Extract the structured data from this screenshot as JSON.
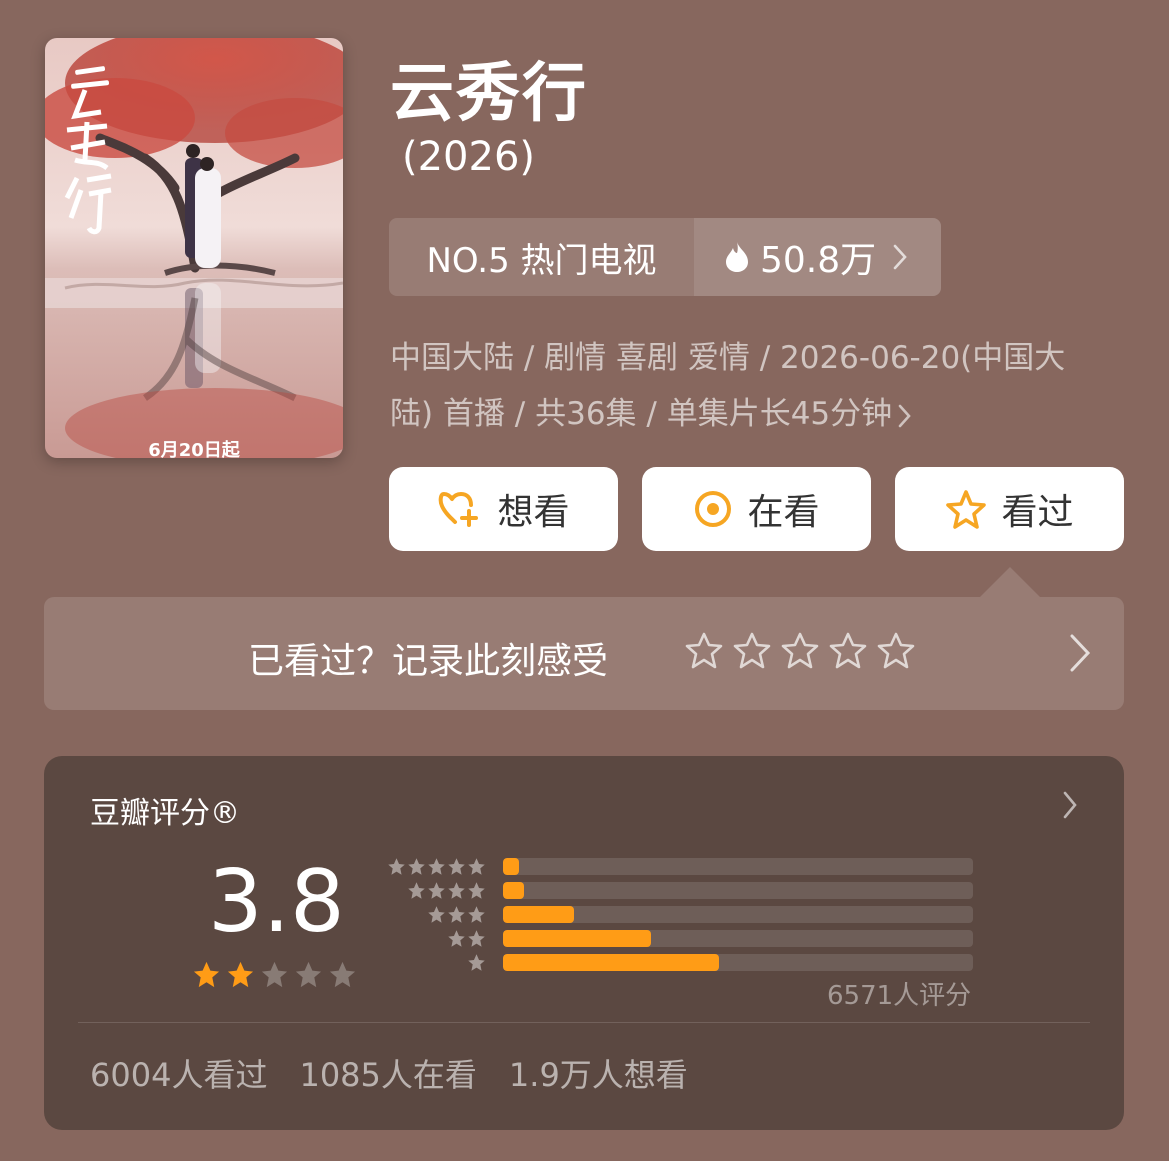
{
  "show": {
    "title": "云秀行",
    "year": "(2026)",
    "poster": {
      "calligraphy": "云秀行",
      "date_text": "6月20日起"
    }
  },
  "ranking": {
    "rank_label": "NO.5 热门电视",
    "heat_value": "50.8万",
    "heat_icon": "flame-icon"
  },
  "meta": {
    "line1": "中国大陆 / 剧情 喜剧 爱情 / 2026-06-20(中国大",
    "line2": "陆) 首播 / 共36集 / 单集片长45分钟"
  },
  "actions": [
    {
      "label": "想看",
      "icon": "heart-plus-icon"
    },
    {
      "label": "在看",
      "icon": "target-icon"
    },
    {
      "label": "看过",
      "icon": "star-outline-icon"
    }
  ],
  "record": {
    "prompt": "已看过？记录此刻感受",
    "star_count": 5
  },
  "rating": {
    "label": "豆瓣评分®",
    "score": "3.8",
    "stars_filled": 2,
    "stars_total": 5,
    "distribution": [
      {
        "stars": 5,
        "fraction": 0.035
      },
      {
        "stars": 4,
        "fraction": 0.045
      },
      {
        "stars": 3,
        "fraction": 0.15
      },
      {
        "stars": 2,
        "fraction": 0.315
      },
      {
        "stars": 1,
        "fraction": 0.46
      }
    ],
    "count_text": "6571人评分"
  },
  "stats": {
    "watched": "6004人看过",
    "watching": "1085人在看",
    "wish": "1.9万人想看"
  },
  "colors": {
    "background": "#87675e",
    "card": "#5b4841",
    "accent": "#ff9c16",
    "icon_orange": "#f6a623"
  }
}
